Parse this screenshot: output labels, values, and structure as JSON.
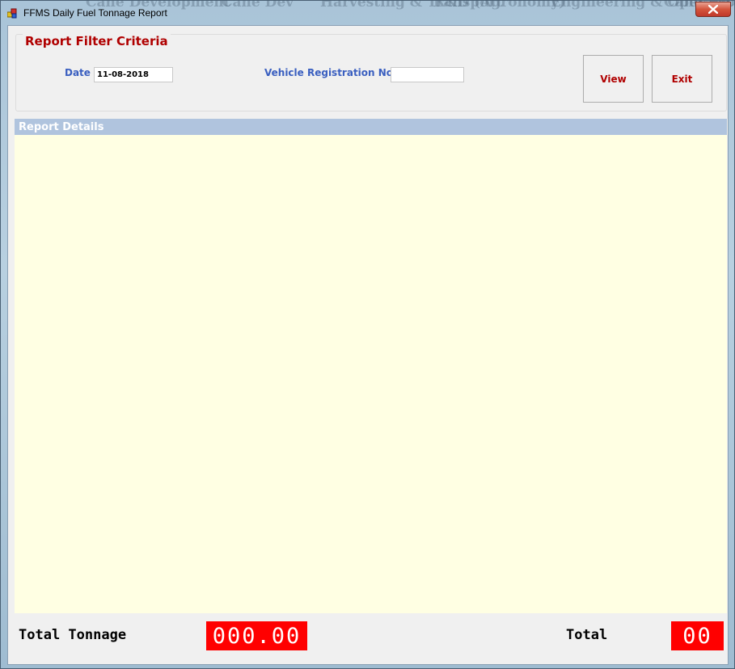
{
  "window": {
    "title": "FFMS Daily Fuel Tonnage Report",
    "background_menu": [
      "Cane Development",
      "Cane Dev",
      "Harvesting & Transport",
      "R&D (Agronomy)",
      "Engineering & Operation",
      "Cane Account"
    ]
  },
  "filter": {
    "title": "Report Filter Criteria",
    "date_label": "Date",
    "date_value": "11-08-2018",
    "vehicle_label": "Vehicle Registration No",
    "vehicle_value": "",
    "view_label": "View",
    "exit_label": "Exit"
  },
  "details": {
    "header": "Report Details"
  },
  "footer": {
    "total_tonnage_label": "Total Tonnage",
    "total_tonnage_value": "000.00",
    "total_label": "Total",
    "total_value": "00"
  },
  "colors": {
    "accent_red": "#b00000",
    "label_blue": "#3a5fc0",
    "details_header": "#b0c4de",
    "details_body": "#ffffe3",
    "counter_bg": "#ff0000"
  }
}
